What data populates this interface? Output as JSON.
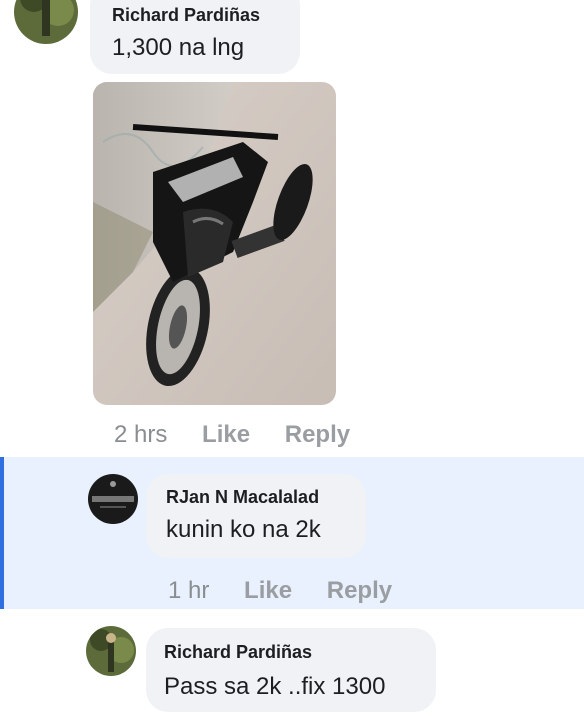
{
  "comments": [
    {
      "author": "Richard Pardiñas",
      "text": "1,300 na lng",
      "time": "2 hrs",
      "like": "Like",
      "reply": "Reply",
      "has_photo": true
    },
    {
      "author": "RJan N Macalalad",
      "text": "kunin ko na 2k",
      "time": "1 hr",
      "like": "Like",
      "reply": "Reply"
    },
    {
      "author": "Richard Pardiñas",
      "text": "Pass sa 2k ..fix 1300"
    }
  ],
  "colors": {
    "highlight_bg": "#e8f1fd",
    "highlight_border": "#2f6fe0",
    "bubble_bg": "#f0f2f5",
    "meta_text": "#8a8d91"
  }
}
